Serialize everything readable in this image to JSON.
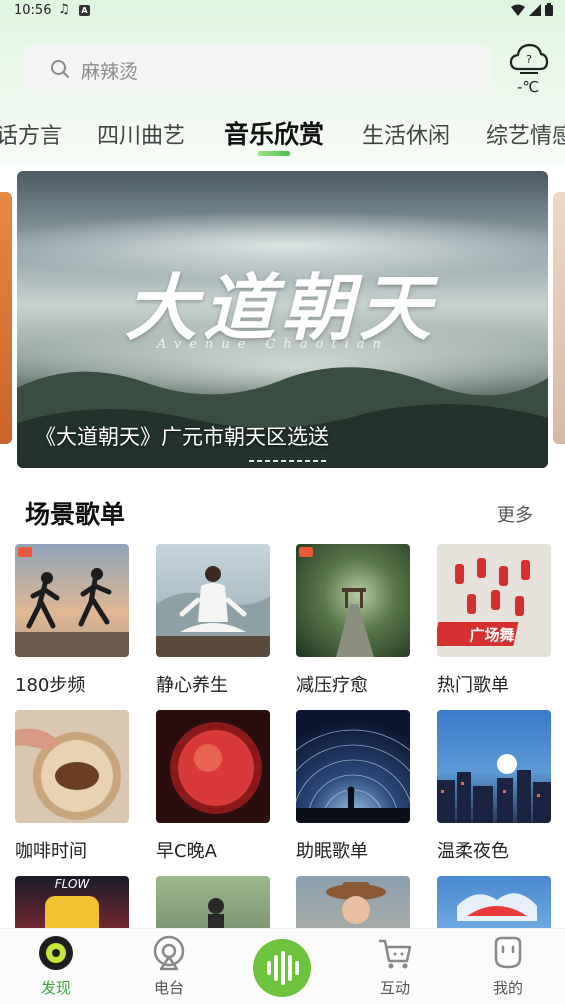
{
  "status_bar": {
    "time": "10:56"
  },
  "search": {
    "placeholder": "麻辣烫"
  },
  "weather": {
    "temperature": "-℃"
  },
  "tabs": [
    {
      "label": "话方言",
      "active": false
    },
    {
      "label": "四川曲艺",
      "active": false
    },
    {
      "label": "音乐欣赏",
      "active": true
    },
    {
      "label": "生活休闲",
      "active": false
    },
    {
      "label": "综艺情感",
      "active": false
    }
  ],
  "banner": {
    "title": "大道朝天",
    "subtitle": "Avenue Chaotian",
    "caption": "《大道朝天》广元市朝天区选送"
  },
  "section": {
    "title": "场景歌单",
    "more": "更多"
  },
  "playlists": [
    {
      "label": "180步频"
    },
    {
      "label": "静心养生"
    },
    {
      "label": "减压疗愈"
    },
    {
      "label": "热门歌单",
      "badge": "广场舞"
    },
    {
      "label": "咖啡时间"
    },
    {
      "label": "早C晚A"
    },
    {
      "label": "助眠歌单"
    },
    {
      "label": "温柔夜色"
    },
    {
      "label": "",
      "badge": "FLOW"
    },
    {
      "label": ""
    },
    {
      "label": ""
    },
    {
      "label": ""
    }
  ],
  "bottom_nav": [
    {
      "label": "发现",
      "active": true
    },
    {
      "label": "电台",
      "active": false
    },
    {
      "label": "",
      "active": false
    },
    {
      "label": "互动",
      "active": false
    },
    {
      "label": "我的",
      "active": false
    }
  ],
  "colors": {
    "accent": "#3ba547",
    "center_button": "#6bc43c"
  }
}
